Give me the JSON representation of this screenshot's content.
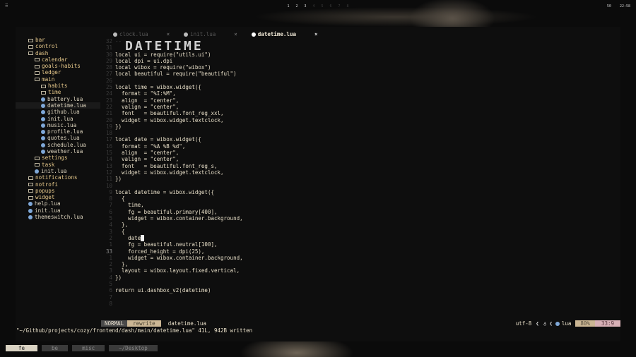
{
  "topbar": {
    "left": "⠿",
    "workspaces": [
      "1",
      "2",
      "3",
      "4",
      "5",
      "6",
      "7",
      "8"
    ],
    "right_a": "50",
    "clock": "22:58"
  },
  "tree": [
    {
      "label": "bar",
      "type": "dir",
      "depth": 0
    },
    {
      "label": "control",
      "type": "dir",
      "depth": 0
    },
    {
      "label": "dash",
      "type": "dir",
      "depth": 0
    },
    {
      "label": "calendar",
      "type": "dir",
      "depth": 1
    },
    {
      "label": "goals-habits",
      "type": "dir",
      "depth": 1
    },
    {
      "label": "ledger",
      "type": "dir",
      "depth": 1
    },
    {
      "label": "main",
      "type": "dir",
      "depth": 1
    },
    {
      "label": "habits",
      "type": "dir",
      "depth": 2
    },
    {
      "label": "time",
      "type": "dir",
      "depth": 2
    },
    {
      "label": "battery.lua",
      "type": "lua",
      "depth": 2
    },
    {
      "label": "datetime.lua",
      "type": "lua",
      "depth": 2,
      "selected": true
    },
    {
      "label": "github.lua",
      "type": "lua",
      "depth": 2
    },
    {
      "label": "init.lua",
      "type": "lua",
      "depth": 2
    },
    {
      "label": "music.lua",
      "type": "lua",
      "depth": 2
    },
    {
      "label": "profile.lua",
      "type": "lua",
      "depth": 2
    },
    {
      "label": "quotes.lua",
      "type": "lua",
      "depth": 2
    },
    {
      "label": "schedule.lua",
      "type": "lua",
      "depth": 2
    },
    {
      "label": "weather.lua",
      "type": "lua",
      "depth": 2
    },
    {
      "label": "settings",
      "type": "dir",
      "depth": 1
    },
    {
      "label": "task",
      "type": "dir",
      "depth": 1
    },
    {
      "label": "init.lua",
      "type": "lua",
      "depth": 1
    },
    {
      "label": "notifications",
      "type": "dir",
      "depth": 0
    },
    {
      "label": "notrofi",
      "type": "dir",
      "depth": 0
    },
    {
      "label": "popups",
      "type": "dir",
      "depth": 0
    },
    {
      "label": "widget",
      "type": "dir",
      "depth": 0
    },
    {
      "label": "help.lua",
      "type": "lua",
      "depth": 0
    },
    {
      "label": "init.lua",
      "type": "lua",
      "depth": 0
    },
    {
      "label": "themeswitch.lua",
      "type": "lua",
      "depth": 0
    }
  ],
  "tabs": [
    {
      "label": "clock.lua",
      "close": "×",
      "active": false
    },
    {
      "label": "init.lua",
      "close": "×",
      "active": false
    },
    {
      "label": "datetime.lua",
      "close": "×",
      "active": true
    }
  ],
  "gutter": [
    "32",
    "31",
    "30",
    "29",
    "28",
    "27",
    "26",
    "25",
    "24",
    "23",
    "22",
    "21",
    "20",
    "19",
    "18",
    "17",
    "16",
    "15",
    "14",
    "13",
    "12",
    "11",
    "10",
    "9",
    "8",
    "7",
    "6",
    "5",
    "4",
    "3",
    "2",
    "1",
    "33",
    "1",
    "2",
    "3",
    "4",
    "5",
    "6",
    "7",
    "8"
  ],
  "code": [
    "",
    "",
    "",
    "local ui = require(\"utils.ui\")",
    "local dpi = ui.dpi",
    "local wibox = require(\"wibox\")",
    "local beautiful = require(\"beautiful\")",
    "",
    "local time = wibox.widget({",
    "  format = \"%I:%M\",",
    "  align  = \"center\",",
    "  valign = \"center\",",
    "  font   = beautiful.font_reg_xxl,",
    "  widget = wibox.widget.textclock,",
    "})",
    "",
    "local date = wibox.widget({",
    "  format = \"%A %B %d\",",
    "  align  = \"center\",",
    "  valign = \"center\",",
    "  font   = beautiful.font_reg_s,",
    "  widget = wibox.widget.textclock,",
    "})",
    "",
    "local datetime = wibox.widget({",
    "  {",
    "    time,",
    "    fg = beautiful.primary[400],",
    "    widget = wibox.container.background,",
    "  },",
    "  {",
    "    date",
    "    fg = beautiful.neutral[100],",
    "    forced_height = dpi(25),",
    "    widget = wibox.container.background,",
    "  },",
    "  layout = wibox.layout.fixed.vertical,",
    "})",
    "",
    "return ui.dashbox_v2(datetime)"
  ],
  "banner": {
    "prefix": "--",
    "art": "DATETIME"
  },
  "status": {
    "mode": "NORMAL",
    "branch": "rewrite",
    "file": "datetime.lua",
    "encoding": "utf-8",
    "filetype": "lua",
    "percent": "80%",
    "position": "33:9"
  },
  "cmdline": "\"~/Github/projects/cozy/frontend/dash/main/datetime.lua\" 41L, 942B written",
  "tmux": [
    {
      "label": "fe",
      "active": true
    },
    {
      "label": "be",
      "active": false
    },
    {
      "label": "misc",
      "active": false
    },
    {
      "label": "~/Desktop",
      "active": false
    }
  ]
}
